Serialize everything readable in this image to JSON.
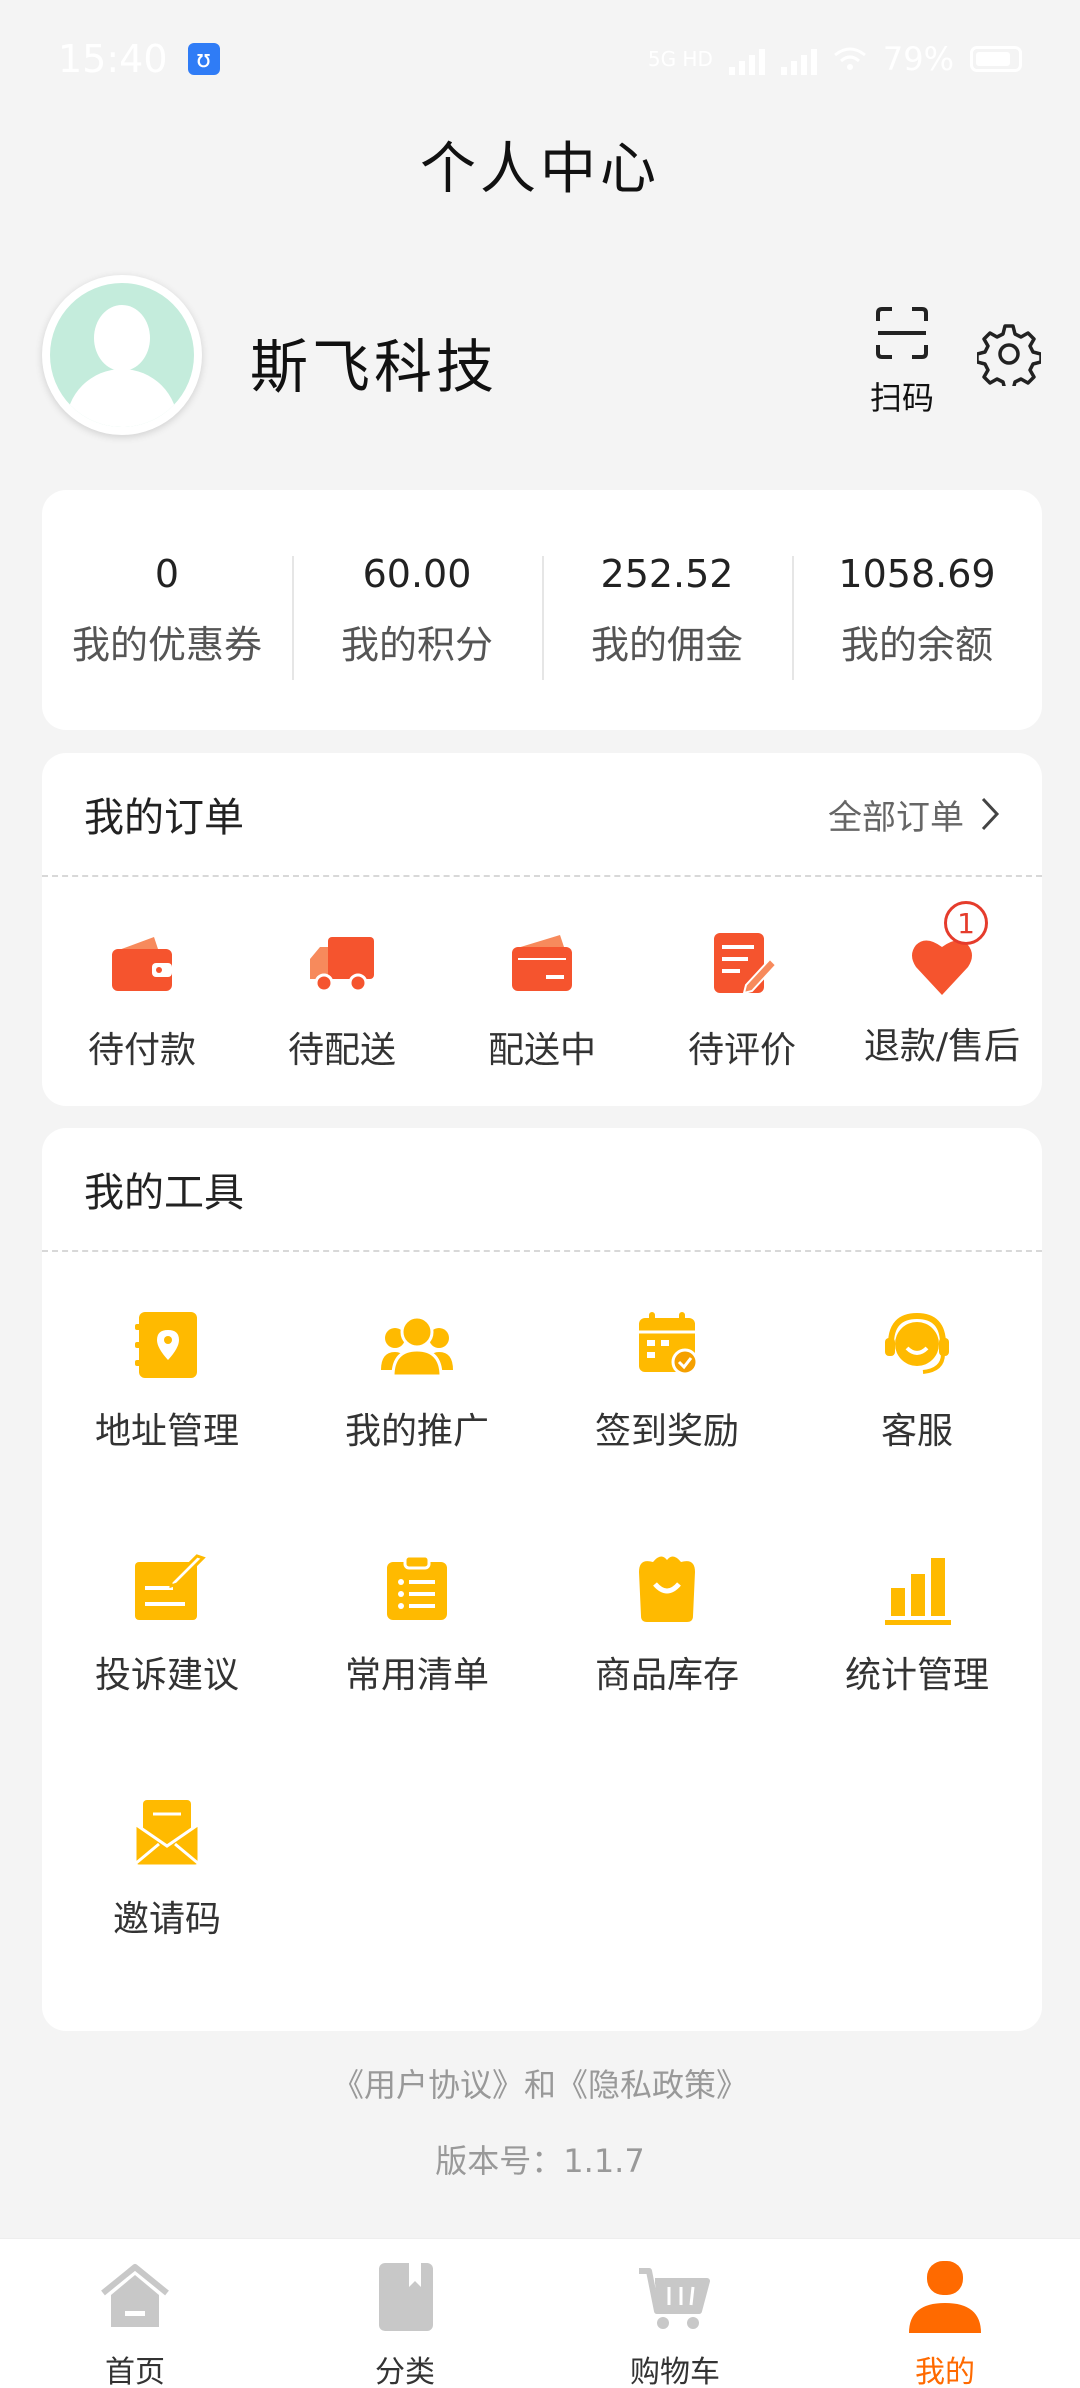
{
  "status_bar": {
    "time": "15:40",
    "battery": "79%",
    "network": "5G HD"
  },
  "header": {
    "title": "个人中心"
  },
  "profile": {
    "name": "斯飞科技",
    "scan_label": "扫码"
  },
  "stats": [
    {
      "value": "0",
      "label": "我的优惠券"
    },
    {
      "value": "60.00",
      "label": "我的积分"
    },
    {
      "value": "252.52",
      "label": "我的佣金"
    },
    {
      "value": "1058.69",
      "label": "我的余额"
    }
  ],
  "orders": {
    "title": "我的订单",
    "more_label": "全部订单",
    "items": [
      {
        "label": "待付款",
        "icon": "wallet-icon"
      },
      {
        "label": "待配送",
        "icon": "truck-icon"
      },
      {
        "label": "配送中",
        "icon": "delivery-icon"
      },
      {
        "label": "待评价",
        "icon": "review-icon"
      },
      {
        "label": "退款/售后",
        "icon": "refund-icon",
        "badge": "1"
      }
    ]
  },
  "tools": {
    "title": "我的工具",
    "items": [
      {
        "label": "地址管理",
        "icon": "address-icon"
      },
      {
        "label": "我的推广",
        "icon": "promotion-icon"
      },
      {
        "label": "签到奖励",
        "icon": "checkin-icon"
      },
      {
        "label": "客服",
        "icon": "customer-service-icon"
      },
      {
        "label": "投诉建议",
        "icon": "complaint-icon"
      },
      {
        "label": "常用清单",
        "icon": "list-icon"
      },
      {
        "label": "商品库存",
        "icon": "inventory-icon"
      },
      {
        "label": "统计管理",
        "icon": "statistics-icon"
      },
      {
        "label": "邀请码",
        "icon": "invite-icon"
      }
    ]
  },
  "footer": {
    "agreement": "《用户协议》和《隐私政策》",
    "version": "版本号：1.1.7"
  },
  "tabbar": [
    {
      "label": "首页",
      "icon": "home-icon"
    },
    {
      "label": "分类",
      "icon": "category-icon"
    },
    {
      "label": "购物车",
      "icon": "cart-icon"
    },
    {
      "label": "我的",
      "icon": "profile-icon",
      "active": true
    }
  ],
  "colors": {
    "order_accent": "#f5542e",
    "tool_accent": "#ffba00",
    "tab_active": "#ff6a00"
  }
}
